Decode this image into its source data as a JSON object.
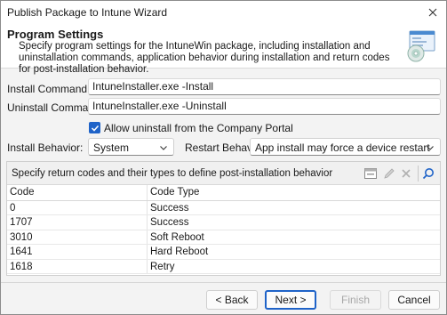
{
  "window": {
    "title": "Publish Package to Intune Wizard"
  },
  "header": {
    "title": "Program Settings",
    "description": "Specify program settings for the IntuneWin package, including installation and uninstallation commands, application behavior during installation and return codes for post-installation behavior."
  },
  "form": {
    "install_label": "Install Command:",
    "install_value": "IntuneInstaller.exe -Install",
    "uninstall_label": "Uninstall Command:",
    "uninstall_value": "IntuneInstaller.exe -Uninstall",
    "allow_uninstall_label": "Allow uninstall from the Company Portal",
    "allow_uninstall_checked": true,
    "install_behavior_label": "Install Behavior:",
    "install_behavior_value": "System",
    "restart_behavior_label": "Restart Behavior:",
    "restart_behavior_value": "App install may force a device restart"
  },
  "return_codes": {
    "caption": "Specify return codes and their types to define post-installation behavior",
    "columns": [
      "Code",
      "Code Type"
    ],
    "rows": [
      {
        "code": "0",
        "type": "Success"
      },
      {
        "code": "1707",
        "type": "Success"
      },
      {
        "code": "3010",
        "type": "Soft Reboot"
      },
      {
        "code": "1641",
        "type": "Hard Reboot"
      },
      {
        "code": "1618",
        "type": "Retry"
      }
    ]
  },
  "buttons": {
    "back": "< Back",
    "next": "Next >",
    "finish": "Finish",
    "cancel": "Cancel"
  },
  "colors": {
    "accent": "#1f63c8"
  }
}
